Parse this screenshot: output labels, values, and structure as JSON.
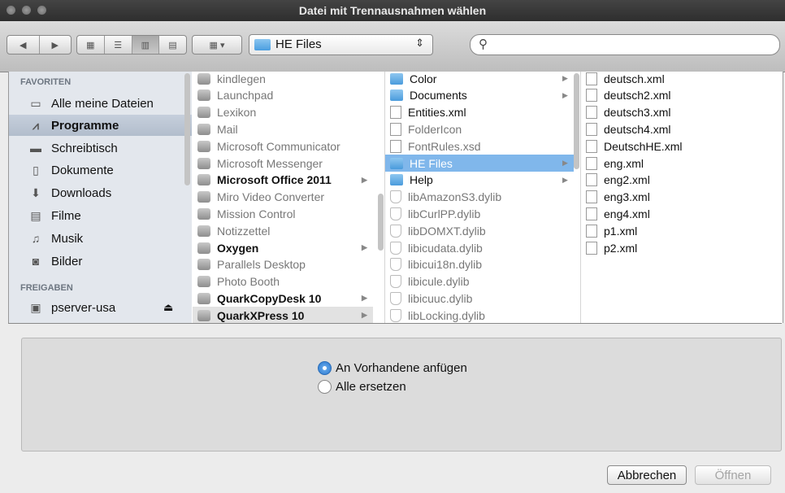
{
  "window": {
    "title": "Datei mit Trennausnahmen wählen"
  },
  "toolbar": {
    "view_icons": [
      "icon-view-icon",
      "list-view-icon",
      "column-view-icon",
      "coverflow-view-icon"
    ],
    "path_popup": "HE Files",
    "search_placeholder": ""
  },
  "sidebar": {
    "favorites_header": "FAVORITEN",
    "items": [
      {
        "label": "Alle meine Dateien",
        "icon": "all-files-icon"
      },
      {
        "label": "Programme",
        "icon": "applications-icon",
        "selected": true
      },
      {
        "label": "Schreibtisch",
        "icon": "desktop-icon"
      },
      {
        "label": "Dokumente",
        "icon": "documents-icon"
      },
      {
        "label": "Downloads",
        "icon": "downloads-icon"
      },
      {
        "label": "Filme",
        "icon": "movies-icon"
      },
      {
        "label": "Musik",
        "icon": "music-icon"
      },
      {
        "label": "Bilder",
        "icon": "pictures-icon"
      }
    ],
    "shared_header": "FREIGABEN",
    "shared_items": [
      {
        "label": "pserver-usa",
        "icon": "server-icon"
      }
    ]
  },
  "columns": {
    "apps": [
      {
        "label": "kindlegen",
        "style": "grey"
      },
      {
        "label": "Launchpad",
        "style": "grey"
      },
      {
        "label": "Lexikon",
        "style": "grey"
      },
      {
        "label": "Mail",
        "style": "grey"
      },
      {
        "label": "Microsoft Communicator",
        "style": "grey"
      },
      {
        "label": "Microsoft Messenger",
        "style": "grey"
      },
      {
        "label": "Microsoft Office 2011",
        "style": "bold",
        "folder": true
      },
      {
        "label": "Miro Video Converter",
        "style": "grey"
      },
      {
        "label": "Mission Control",
        "style": "grey"
      },
      {
        "label": "Notizzettel",
        "style": "grey"
      },
      {
        "label": "Oxygen",
        "style": "bold",
        "folder": true
      },
      {
        "label": "Parallels Desktop",
        "style": "grey"
      },
      {
        "label": "Photo Booth",
        "style": "grey"
      },
      {
        "label": "QuarkCopyDesk 10",
        "style": "bold",
        "folder": true
      },
      {
        "label": "QuarkXPress 10",
        "style": "bold",
        "folder": true,
        "shaded": true
      }
    ],
    "quark": [
      {
        "label": "Color",
        "type": "folder"
      },
      {
        "label": "Documents",
        "type": "folder"
      },
      {
        "label": "Entities.xml",
        "type": "doc"
      },
      {
        "label": "FolderIcon",
        "type": "grey"
      },
      {
        "label": "FontRules.xsd",
        "type": "grey"
      },
      {
        "label": "HE Files",
        "type": "folder",
        "selected": true
      },
      {
        "label": "Help",
        "type": "folder"
      },
      {
        "label": "libAmazonS3.dylib",
        "type": "lib"
      },
      {
        "label": "libCurlPP.dylib",
        "type": "lib"
      },
      {
        "label": "libDOMXT.dylib",
        "type": "lib"
      },
      {
        "label": "libicudata.dylib",
        "type": "lib"
      },
      {
        "label": "libicui18n.dylib",
        "type": "lib"
      },
      {
        "label": "libicule.dylib",
        "type": "lib"
      },
      {
        "label": "libicuuc.dylib",
        "type": "lib"
      },
      {
        "label": "libLocking.dylib",
        "type": "lib"
      }
    ],
    "files": [
      "deutsch.xml",
      "deutsch2.xml",
      "deutsch3.xml",
      "deutsch4.xml",
      "DeutschHE.xml",
      "eng.xml",
      "eng2.xml",
      "eng3.xml",
      "eng4.xml",
      "p1.xml",
      "p2.xml"
    ]
  },
  "options": {
    "radio1": "An Vorhandene anfügen",
    "radio2": "Alle ersetzen",
    "selected": "radio1"
  },
  "buttons": {
    "cancel": "Abbrechen",
    "open": "Öffnen"
  }
}
